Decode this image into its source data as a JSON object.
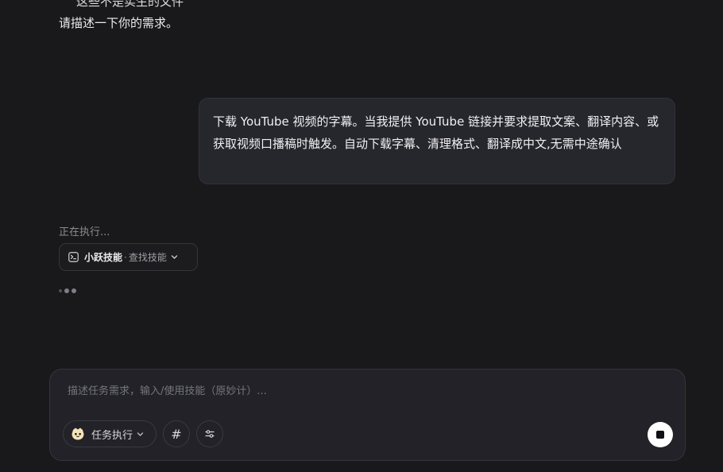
{
  "conversation": {
    "clipped_line": "这些不是实生的文件",
    "assistant_prompt": "请描述一下你的需求。",
    "user_message": "下载 YouTube 视频的字幕。当我提供 YouTube 链接并要求提取文案、翻译内容、或获取视频口播稿时触发。自动下载字幕、清理格式、翻译成中文,无需中途确认"
  },
  "execution": {
    "status": "正在执行...",
    "skill_name": "小跃技能",
    "separator": "·",
    "skill_action": "查找技能"
  },
  "composer": {
    "placeholder": "描述任务需求，输入/使用技能（原妙计）...",
    "mode_label": "任务执行",
    "hash_symbol": "#"
  },
  "icons": {
    "terminal": "terminal-icon",
    "chevron": "chevron-down-icon",
    "mascot": "mascot-icon",
    "settings": "sliders-icon",
    "stop": "stop-icon"
  },
  "colors": {
    "background": "#19191b",
    "bubble": "#26262d",
    "input_background": "#222228",
    "stop_button": "#ffffff"
  }
}
